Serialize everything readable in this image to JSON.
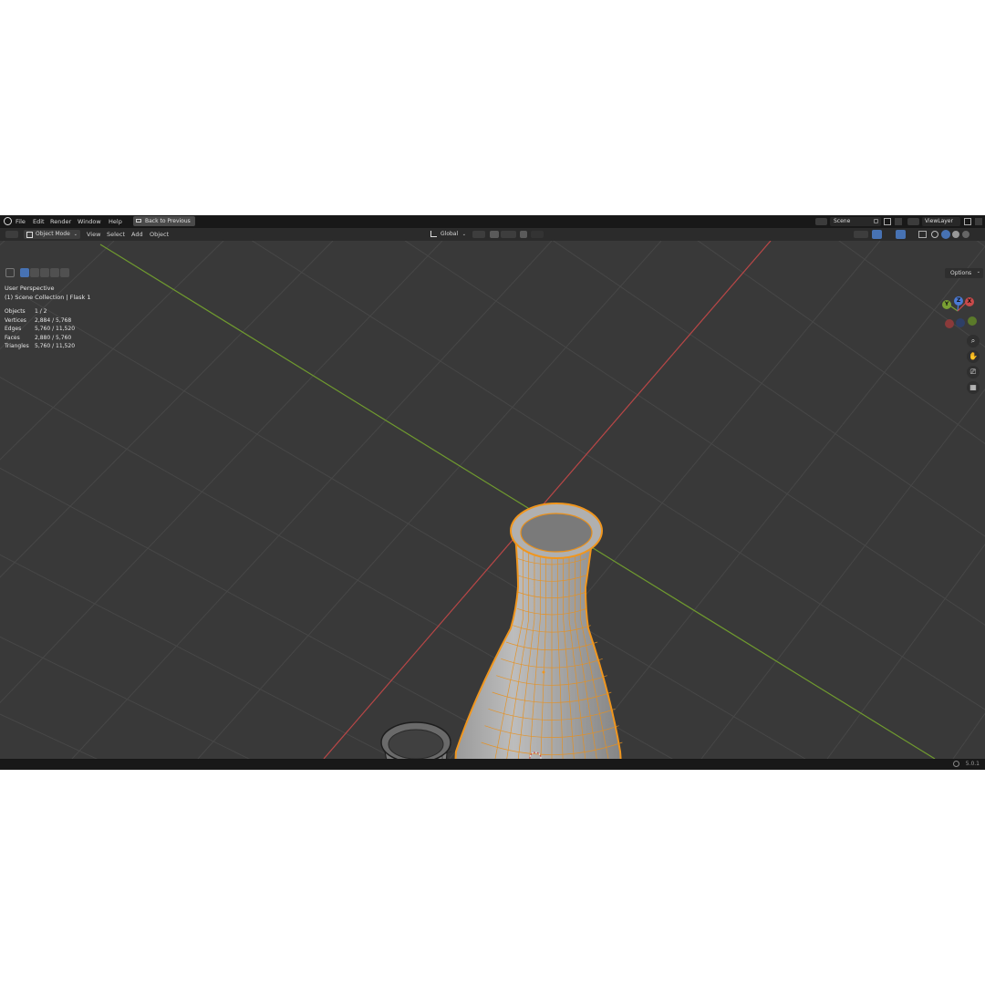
{
  "topbar": {
    "menus": [
      "File",
      "Edit",
      "Render",
      "Window",
      "Help"
    ],
    "back_button": "Back to Previous",
    "scene": "Scene",
    "view_layer": "ViewLayer"
  },
  "header": {
    "mode": "Object Mode",
    "menus": [
      "View",
      "Select",
      "Add",
      "Object"
    ],
    "transform_orientation": "Global"
  },
  "viewport": {
    "perspective": "User Perspective",
    "collection": "(1) Scene Collection | Flask 1",
    "options_label": "Options",
    "stats": [
      {
        "label": "Objects",
        "value": "1 / 2"
      },
      {
        "label": "Vertices",
        "value": "2,884 / 5,768"
      },
      {
        "label": "Edges",
        "value": "5,760 / 11,520"
      },
      {
        "label": "Faces",
        "value": "2,880 / 5,760"
      },
      {
        "label": "Triangles",
        "value": "5,760 / 11,520"
      }
    ],
    "gizmo": {
      "y": "Y",
      "z": "Z",
      "x": "X"
    },
    "colors": {
      "selection": "#f0961e",
      "x_axis": "#c94a4a",
      "y_axis": "#7aa033",
      "grid": "#464646"
    }
  },
  "statusbar": {
    "version": "5.0.1"
  }
}
